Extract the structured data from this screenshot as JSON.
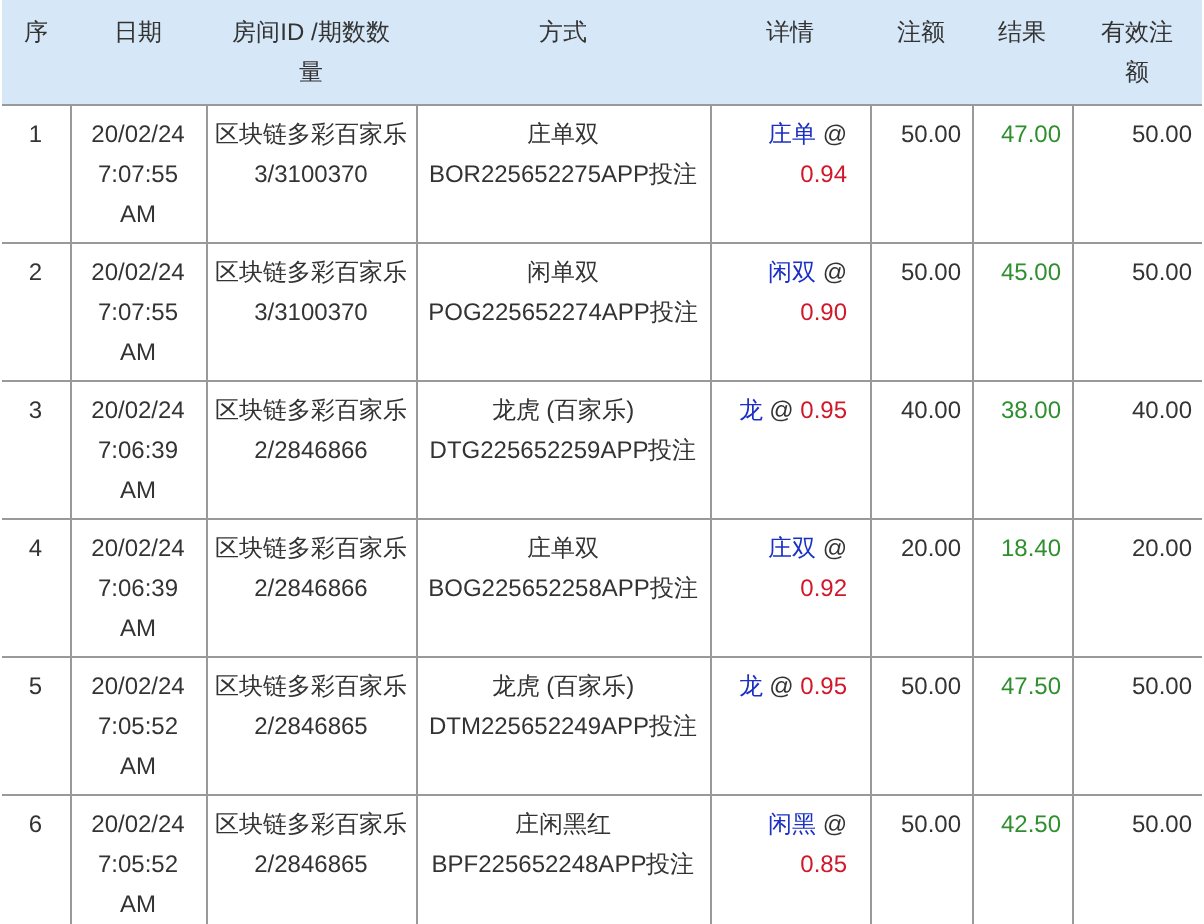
{
  "table": {
    "columns": [
      "序",
      "日期",
      "房间ID /期数数量",
      "方式",
      "详情",
      "注额",
      "结果",
      "有效注额"
    ],
    "rows": [
      {
        "index": "1",
        "date": "20/02/24 7:07:55 AM",
        "room": "区块链多彩百家乐",
        "issue": "3/3100370",
        "method": "庄单双",
        "ref": "BOR225652275APP投注",
        "pick": "庄单",
        "separator": "@",
        "odds": "0.94",
        "amount": "50.00",
        "result": "47.00",
        "valid": "50.00"
      },
      {
        "index": "2",
        "date": "20/02/24 7:07:55 AM",
        "room": "区块链多彩百家乐",
        "issue": "3/3100370",
        "method": "闲单双",
        "ref": "POG225652274APP投注",
        "pick": "闲双",
        "separator": "@",
        "odds": "0.90",
        "amount": "50.00",
        "result": "45.00",
        "valid": "50.00"
      },
      {
        "index": "3",
        "date": "20/02/24 7:06:39 AM",
        "room": "区块链多彩百家乐",
        "issue": "2/2846866",
        "method": "龙虎 (百家乐)",
        "ref": "DTG225652259APP投注",
        "pick": "龙",
        "separator": "@",
        "odds": "0.95",
        "amount": "40.00",
        "result": "38.00",
        "valid": "40.00"
      },
      {
        "index": "4",
        "date": "20/02/24 7:06:39 AM",
        "room": "区块链多彩百家乐",
        "issue": "2/2846866",
        "method": "庄单双",
        "ref": "BOG225652258APP投注",
        "pick": "庄双",
        "separator": "@",
        "odds": "0.92",
        "amount": "20.00",
        "result": "18.40",
        "valid": "20.00"
      },
      {
        "index": "5",
        "date": "20/02/24 7:05:52 AM",
        "room": "区块链多彩百家乐",
        "issue": "2/2846865",
        "method": "龙虎 (百家乐)",
        "ref": "DTM225652249APP投注",
        "pick": "龙",
        "separator": "@",
        "odds": "0.95",
        "amount": "50.00",
        "result": "47.50",
        "valid": "50.00"
      },
      {
        "index": "6",
        "date": "20/02/24 7:05:52 AM",
        "room": "区块链多彩百家乐",
        "issue": "2/2846865",
        "method": "庄闲黑红",
        "ref": "BPF225652248APP投注",
        "pick": "闲黑",
        "separator": "@",
        "odds": "0.85",
        "amount": "50.00",
        "result": "42.50",
        "valid": "50.00"
      }
    ]
  }
}
